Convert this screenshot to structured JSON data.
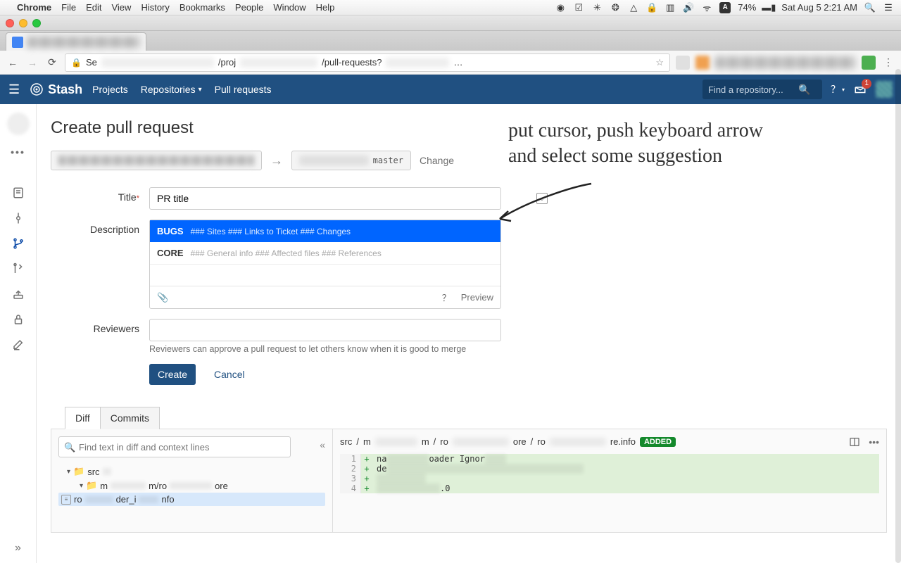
{
  "mac_menu": {
    "app": "Chrome",
    "items": [
      "File",
      "Edit",
      "View",
      "History",
      "Bookmarks",
      "People",
      "Window",
      "Help"
    ],
    "battery": "74%",
    "clock": "Sat Aug 5  2:21 AM"
  },
  "omnibox": {
    "prefix": "Se",
    "middle1": "/proj",
    "middle2": "/pull-requests?"
  },
  "stash": {
    "logo": "Stash",
    "nav": {
      "projects": "Projects",
      "repositories": "Repositories",
      "pull_requests": "Pull requests"
    },
    "search_placeholder": "Find a repository...",
    "inbox_badge": "1"
  },
  "page": {
    "title": "Create pull request",
    "dest_branch": "master",
    "change": "Change"
  },
  "form": {
    "title_label": "Title",
    "title_value": "PR title",
    "desc_label": "Description",
    "reviewers_label": "Reviewers",
    "reviewers_help": "Reviewers can approve a pull request to let others know when it is good to merge",
    "preview": "Preview",
    "create": "Create",
    "cancel": "Cancel",
    "suggestions": [
      {
        "name": "BUGS",
        "preview": "### Sites ### Links to Ticket ### Changes"
      },
      {
        "name": "CORE",
        "preview": "### General info ### Affected files ### References"
      }
    ]
  },
  "annotation": {
    "line1": "put cursor, push keyboard arrow",
    "line2": "and select some suggestion"
  },
  "tabs": {
    "diff": "Diff",
    "commits": "Commits"
  },
  "diff": {
    "search_placeholder": "Find text in diff and context lines",
    "tree": {
      "root": "src",
      "sub_prefix": "m",
      "sub_mid": "m/ro",
      "sub_suffix": "ore",
      "file_prefix": "ro",
      "file_mid": "der_i",
      "file_suffix": "nfo"
    },
    "path": {
      "p1": "src",
      "p2_pre": "m",
      "p2_suf": "m",
      "p3_pre": "ro",
      "p3_suf": "ore",
      "p4_pre": "ro",
      "p4_suf": "re.info",
      "added": "ADDED"
    },
    "lines": [
      {
        "n": "1",
        "pre": "na",
        "mid": "oader Ignor",
        "suf": ""
      },
      {
        "n": "2",
        "pre": "de",
        "mid": "",
        "suf": ""
      },
      {
        "n": "3",
        "pre": "",
        "mid": "",
        "suf": ""
      },
      {
        "n": "4",
        "pre": "",
        "mid": ".0",
        "suf": ""
      }
    ]
  }
}
